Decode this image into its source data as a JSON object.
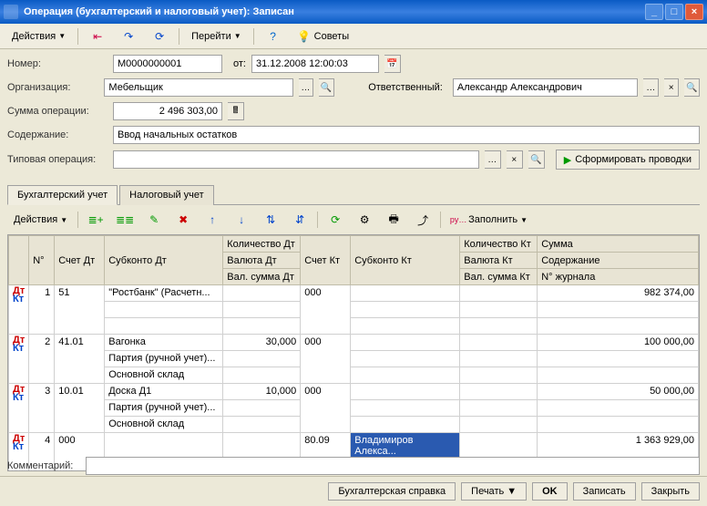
{
  "window": {
    "title": "Операция (бухгалтерский и налоговый учет): Записан"
  },
  "toolbar": {
    "actions": "Действия",
    "goto": "Перейти",
    "tips": "Советы"
  },
  "form": {
    "number_lbl": "Номер:",
    "number": "М0000000001",
    "from_lbl": "от:",
    "date": "31.12.2008 12:00:03",
    "org_lbl": "Организация:",
    "org": "Мебельщик",
    "resp_lbl": "Ответственный:",
    "resp": "Александр Александрович",
    "sum_lbl": "Сумма операции:",
    "sum": "2 496 303,00",
    "content_lbl": "Содержание:",
    "content": "Ввод начальных остатков",
    "typop_lbl": "Типовая операция:",
    "typop": "",
    "form_btn": "Сформировать проводки"
  },
  "tabs": {
    "t1": "Бухгалтерский учет",
    "t2": "Налоговый учет"
  },
  "subtb": {
    "actions": "Действия",
    "fill": "Заполнить"
  },
  "headers": {
    "n": "N°",
    "schdt": "Счет Дт",
    "subdt": "Субконто Дт",
    "qtydt": "Количество Дт",
    "schkt": "Счет Кт",
    "subkt": "Субконто Кт",
    "qtykt": "Количество Кт",
    "sum": "Сумма",
    "valdt": "Валюта Дт",
    "valkt": "Валюта Кт",
    "cont": "Содержание",
    "vsdt": "Вал. сумма Дт",
    "vskt": "Вал. сумма Кт",
    "jrn": "N° журнала"
  },
  "rows": [
    {
      "n": "1",
      "schdt": "51",
      "subdt": [
        "\"Ростбанк\" (Расчетн...",
        "",
        ""
      ],
      "qtydt": [
        "",
        "",
        ""
      ],
      "schkt": "000",
      "subkt": [
        "",
        "",
        ""
      ],
      "qtykt": [
        "",
        "",
        ""
      ],
      "sum": [
        "982 374,00",
        "",
        ""
      ]
    },
    {
      "n": "2",
      "schdt": "41.01",
      "subdt": [
        "Вагонка",
        "Партия (ручной учет)...",
        "Основной склад"
      ],
      "qtydt": [
        "30,000",
        "",
        ""
      ],
      "schkt": "000",
      "subkt": [
        "",
        "",
        ""
      ],
      "qtykt": [
        "",
        "",
        ""
      ],
      "sum": [
        "100 000,00",
        "",
        ""
      ]
    },
    {
      "n": "3",
      "schdt": "10.01",
      "subdt": [
        "Доска Д1",
        "Партия (ручной учет)...",
        "Основной склад"
      ],
      "qtydt": [
        "10,000",
        "",
        ""
      ],
      "schkt": "000",
      "subkt": [
        "",
        "",
        ""
      ],
      "qtykt": [
        "",
        "",
        ""
      ],
      "sum": [
        "50 000,00",
        "",
        ""
      ]
    },
    {
      "n": "4",
      "schdt": "000",
      "subdt": [
        "",
        "",
        ""
      ],
      "qtydt": [
        "",
        "",
        ""
      ],
      "schkt": "80.09",
      "subkt": [
        "Владимиров Алекса...",
        "",
        ""
      ],
      "qtykt": [
        "",
        "",
        ""
      ],
      "sum": [
        "1 363 929,00",
        "",
        ""
      ]
    }
  ],
  "comment_lbl": "Комментарий:",
  "comment": "",
  "footer": {
    "ref": "Бухгалтерская справка",
    "print": "Печать",
    "ok": "OK",
    "save": "Записать",
    "close": "Закрыть"
  }
}
